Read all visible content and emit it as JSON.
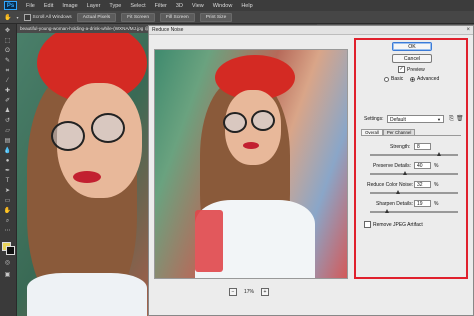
{
  "app": {
    "logo": "Ps"
  },
  "menubar": {
    "items": [
      "File",
      "Edit",
      "Image",
      "Layer",
      "Type",
      "Select",
      "Filter",
      "3D",
      "View",
      "Window",
      "Help"
    ]
  },
  "options_bar": {
    "scroll_all_windows": "Scroll All Windows",
    "buttons": [
      "Actual Pixels",
      "Fit Screen",
      "Fill Screen",
      "Print Size"
    ]
  },
  "document": {
    "tab_title": "beautiful-young-woman-holding-a-drink-while-(WXNA/MJ.jpg @ 6..."
  },
  "dialog": {
    "title": "Reduce Noise",
    "zoom": "17%",
    "ok_label": "OK",
    "cancel_label": "Cancel",
    "preview_label": "Preview",
    "preview_checked": true,
    "mode_options": [
      {
        "label": "Basic",
        "selected": false
      },
      {
        "label": "Advanced",
        "selected": true
      }
    ],
    "settings_label": "Settings:",
    "settings_value": "Default",
    "tabs": [
      {
        "label": "Overall",
        "active": true
      },
      {
        "label": "Per Channel",
        "active": false
      }
    ],
    "sliders": [
      {
        "label": "Strength:",
        "value": "8",
        "unit": "",
        "fraction": 0.8
      },
      {
        "label": "Preserve Details:",
        "value": "40",
        "unit": "%",
        "fraction": 0.4
      },
      {
        "label": "Reduce Color Noise:",
        "value": "32",
        "unit": "%",
        "fraction": 0.32
      },
      {
        "label": "Sharpen Details:",
        "value": "19",
        "unit": "%",
        "fraction": 0.19
      }
    ],
    "remove_jpeg_label": "Remove JPEG Artifact",
    "remove_jpeg_checked": false,
    "highlight_color": "#e0202c"
  }
}
